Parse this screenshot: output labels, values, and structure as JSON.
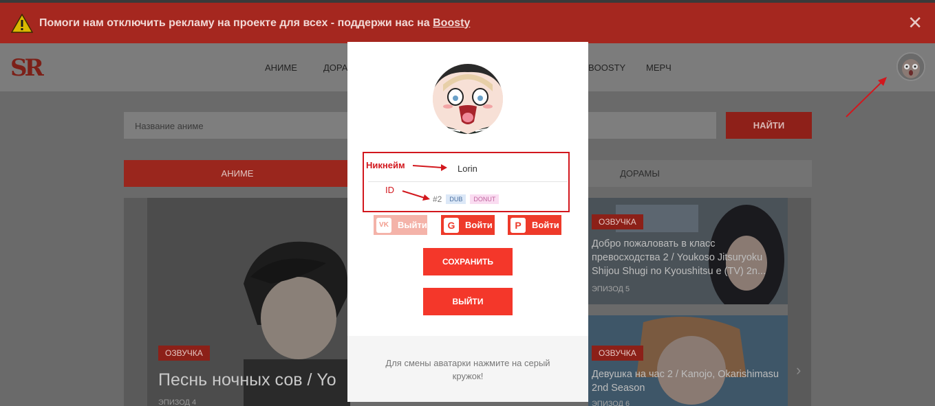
{
  "banner": {
    "text": "Помоги нам отключить рекламу на проекте для всех - поддержи нас на ",
    "link": "Boosty",
    "close": "✕"
  },
  "header": {
    "logo": "SR",
    "nav": [
      "АНИМЕ",
      "ДОРА",
      "BOOSTY",
      "МЕРЧ"
    ]
  },
  "search": {
    "placeholder": "Название аниме",
    "button": "НАЙТИ"
  },
  "tabs": {
    "anime": "АНИМЕ",
    "dorama": "ДОРАМЫ"
  },
  "featured": {
    "badge": "ОЗВУЧКА",
    "title": "Песнь ночных сов / Yo",
    "episode": "ЭПИЗОД 4"
  },
  "cards": [
    {
      "badge": "ОЗВУЧКА",
      "title": "Добро пожаловать в класс превосходства 2 / Youkoso Jitsuryoku Shijou Shugi no Kyoushitsu e (TV) 2n...",
      "episode": "ЭПИЗОД 5"
    },
    {
      "badge": "ОЗВУЧКА",
      "title": "Девушка на час 2 / Kanojo, Okarishimasu 2nd Season",
      "episode": "ЭПИЗОД 6"
    }
  ],
  "modal": {
    "nickname_label": "Никнейм",
    "nickname": "Lorin",
    "id_label": "ID",
    "id": "#2",
    "tags": [
      "DUB",
      "DONUT"
    ],
    "social": [
      {
        "name": "vk",
        "icon": "VK",
        "label": "Выйти"
      },
      {
        "name": "google",
        "icon": "G",
        "label": "Войти"
      },
      {
        "name": "patreon",
        "icon": "P",
        "label": "Войти"
      }
    ],
    "save": "СОХРАНИТЬ",
    "logout": "ВЫЙТИ",
    "hint": "Для смены аватарки нажмите на серый кружок!"
  },
  "colors": {
    "accent": "#f4372a",
    "annotation": "#d2171d",
    "banner": "#a5271f"
  }
}
